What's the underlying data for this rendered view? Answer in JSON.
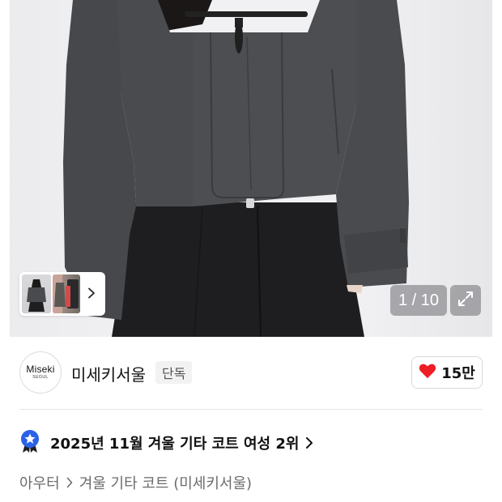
{
  "gallery": {
    "counter": "1 / 10",
    "expand_icon": "expand-icon",
    "thumbnail_next_icon": "chevron-right-icon"
  },
  "brand": {
    "logo_line1": "Miseki",
    "logo_line2": "SEOUL",
    "name": "미세키서울",
    "badge": "단독"
  },
  "like": {
    "icon": "heart-icon",
    "color": "#ee1c25",
    "count": "15만"
  },
  "ranking": {
    "icon": "star-medal-icon",
    "icon_color": "#2a62e8",
    "text": "2025년 11월 겨울 기타 코트 여성 2위"
  },
  "breadcrumb": {
    "items": [
      "아우터",
      "겨울 기타 코트 (미세키서울)"
    ]
  }
}
